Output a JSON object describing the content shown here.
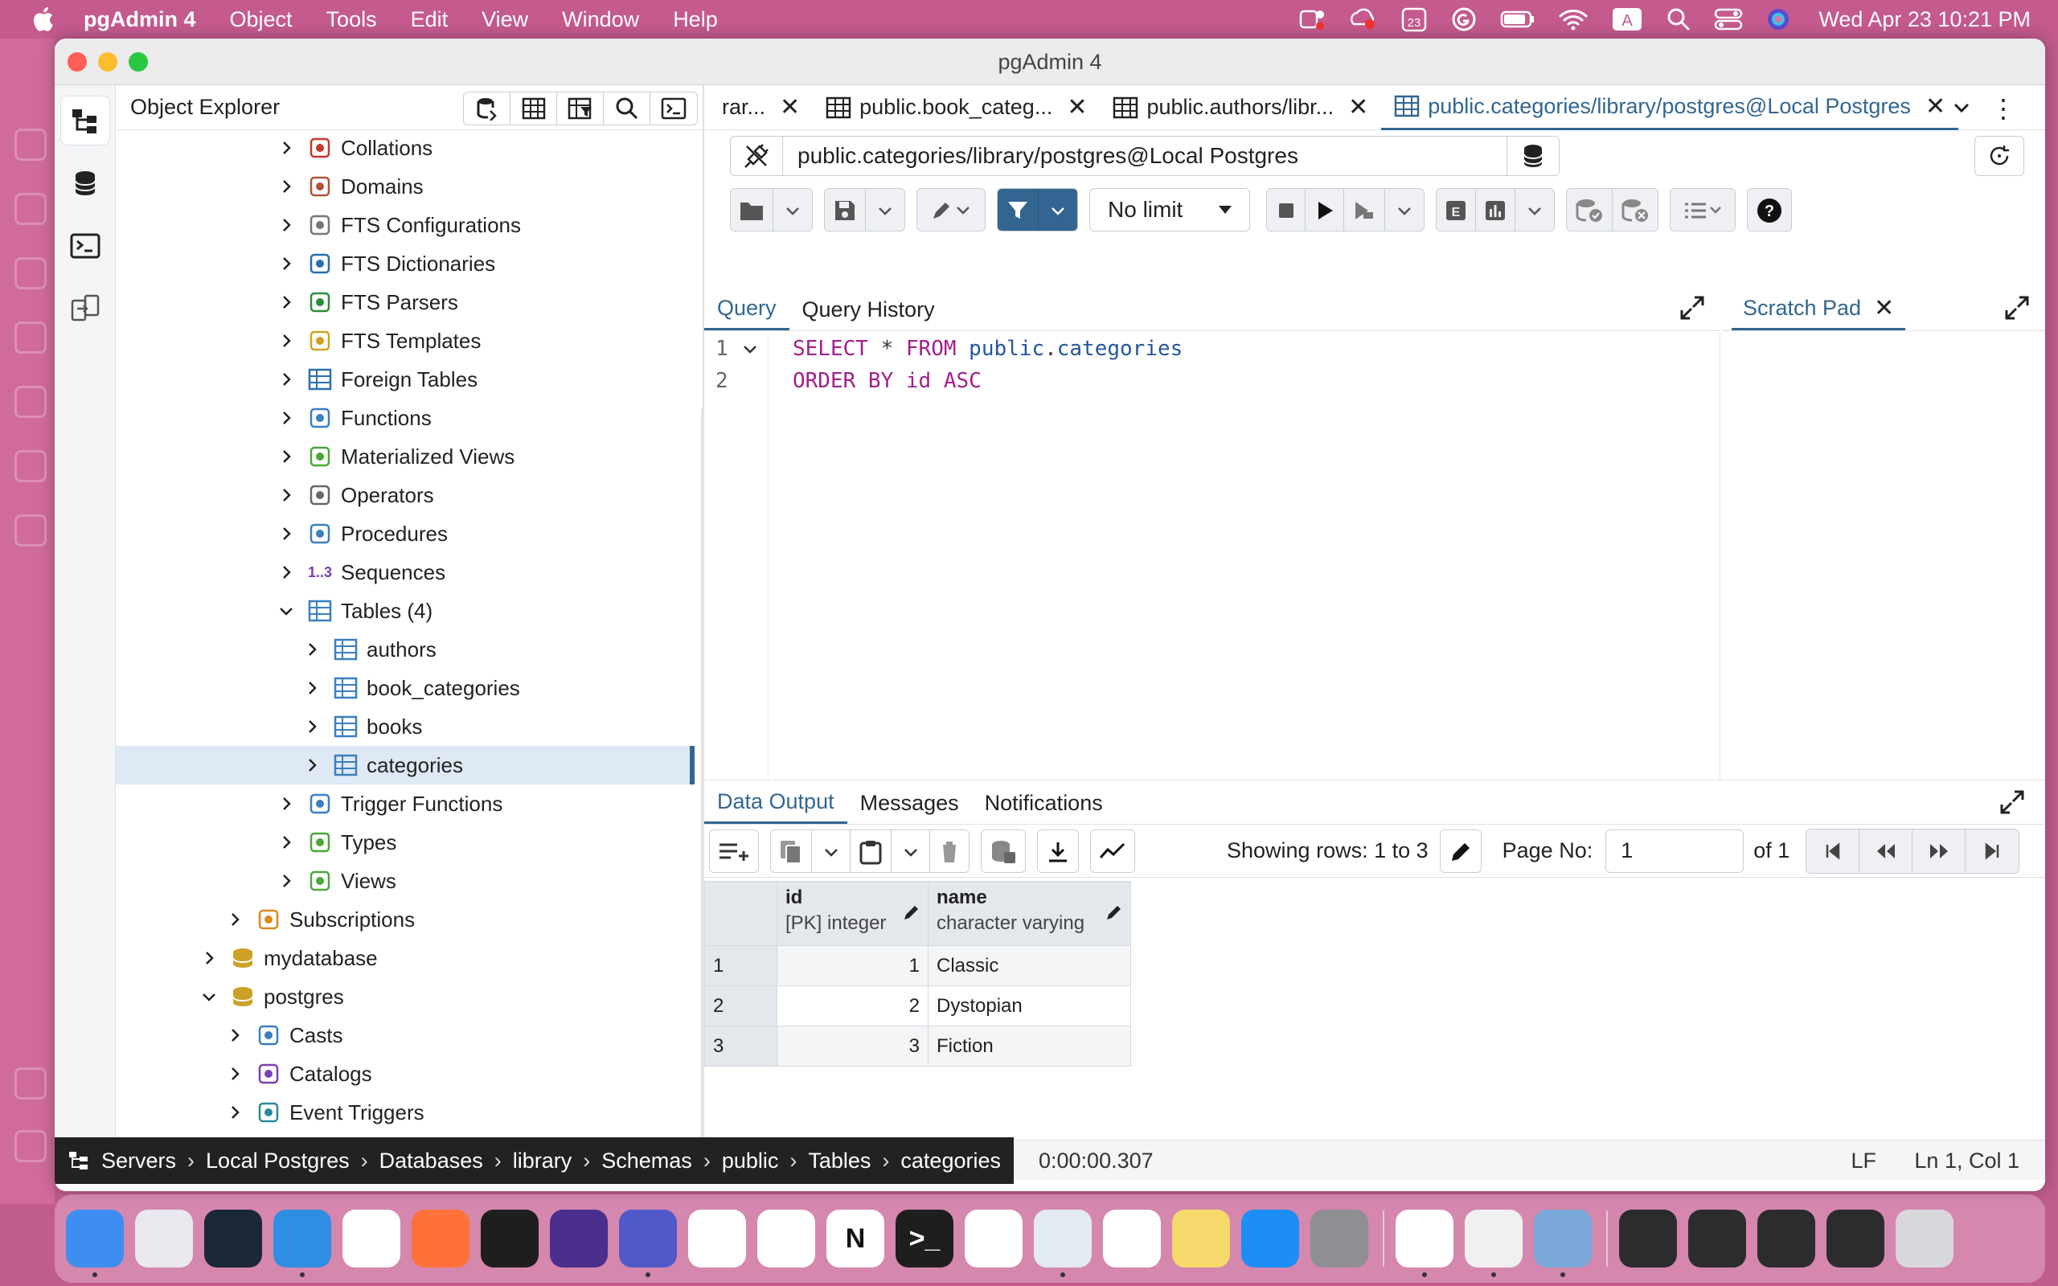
{
  "menubar": {
    "app_name": "pgAdmin 4",
    "menus": [
      "Object",
      "Tools",
      "Edit",
      "View",
      "Window",
      "Help"
    ],
    "calendar_badge": "23",
    "input_badge": "A",
    "clock": "Wed Apr 23  10:21 PM"
  },
  "window": {
    "title": "pgAdmin 4"
  },
  "explorer": {
    "title": "Object Explorer",
    "tree": [
      {
        "label": "Collations",
        "icon": "collations-icon",
        "level": 3,
        "expanded": false
      },
      {
        "label": "Domains",
        "icon": "domains-icon",
        "level": 3,
        "expanded": false
      },
      {
        "label": "FTS Configurations",
        "icon": "fts-config-icon",
        "level": 3,
        "expanded": false
      },
      {
        "label": "FTS Dictionaries",
        "icon": "fts-dictionary-icon",
        "level": 3,
        "expanded": false
      },
      {
        "label": "FTS Parsers",
        "icon": "fts-parser-icon",
        "level": 3,
        "expanded": false
      },
      {
        "label": "FTS Templates",
        "icon": "fts-template-icon",
        "level": 3,
        "expanded": false
      },
      {
        "label": "Foreign Tables",
        "icon": "foreign-table-icon",
        "level": 3,
        "expanded": false
      },
      {
        "label": "Functions",
        "icon": "function-icon",
        "level": 3,
        "expanded": false
      },
      {
        "label": "Materialized Views",
        "icon": "materialized-view-icon",
        "level": 3,
        "expanded": false
      },
      {
        "label": "Operators",
        "icon": "operator-icon",
        "level": 3,
        "expanded": false
      },
      {
        "label": "Procedures",
        "icon": "procedure-icon",
        "level": 3,
        "expanded": false
      },
      {
        "label": "Sequences",
        "icon": "sequence-icon",
        "level": 3,
        "expanded": false,
        "glyph": "1..3"
      },
      {
        "label": "Tables (4)",
        "icon": "tables-icon",
        "level": 3,
        "expanded": true
      },
      {
        "label": "authors",
        "icon": "table-icon",
        "level": 4,
        "expanded": false
      },
      {
        "label": "book_categories",
        "icon": "table-icon",
        "level": 4,
        "expanded": false
      },
      {
        "label": "books",
        "icon": "table-icon",
        "level": 4,
        "expanded": false
      },
      {
        "label": "categories",
        "icon": "table-icon",
        "level": 4,
        "expanded": false,
        "selected": true
      },
      {
        "label": "Trigger Functions",
        "icon": "trigger-function-icon",
        "level": 3,
        "expanded": false
      },
      {
        "label": "Types",
        "icon": "type-icon",
        "level": 3,
        "expanded": false
      },
      {
        "label": "Views",
        "icon": "view-icon",
        "level": 3,
        "expanded": false
      },
      {
        "label": "Subscriptions",
        "icon": "subscription-icon",
        "level": 2,
        "expanded": false
      },
      {
        "label": "mydatabase",
        "icon": "database-icon",
        "level": 1,
        "expanded": false
      },
      {
        "label": "postgres",
        "icon": "database-icon",
        "level": 1,
        "expanded": true
      },
      {
        "label": "Casts",
        "icon": "cast-icon",
        "level": 2,
        "expanded": false
      },
      {
        "label": "Catalogs",
        "icon": "catalog-icon",
        "level": 2,
        "expanded": false
      },
      {
        "label": "Event Triggers",
        "icon": "event-trigger-icon",
        "level": 2,
        "expanded": false
      }
    ]
  },
  "tabs": [
    {
      "label": "rar...",
      "active": false,
      "icon": false
    },
    {
      "label": "public.book_categ...",
      "active": false,
      "icon": true
    },
    {
      "label": "public.authors/libr...",
      "active": false,
      "icon": true
    },
    {
      "label": "public.categories/library/postgres@Local Postgres",
      "active": true,
      "icon": true
    }
  ],
  "connection": {
    "value": "public.categories/library/postgres@Local Postgres"
  },
  "toolbar": {
    "limit": "No limit"
  },
  "query_panel": {
    "tabs": [
      "Query",
      "Query History"
    ],
    "active_tab": "Query",
    "lines": [
      {
        "num": "1",
        "tokens": [
          {
            "t": "SELECT",
            "c": "kw"
          },
          {
            "t": " * ",
            "c": "plain"
          },
          {
            "t": "FROM",
            "c": "kw"
          },
          {
            "t": " ",
            "c": "plain"
          },
          {
            "t": "public",
            "c": "obj"
          },
          {
            "t": ".",
            "c": "plain"
          },
          {
            "t": "categories",
            "c": "obj"
          }
        ]
      },
      {
        "num": "2",
        "tokens": [
          {
            "t": "ORDER BY",
            "c": "kw"
          },
          {
            "t": " ",
            "c": "plain"
          },
          {
            "t": "id",
            "c": "kw"
          },
          {
            "t": " ",
            "c": "plain"
          },
          {
            "t": "ASC",
            "c": "kw"
          }
        ]
      }
    ]
  },
  "scratch_pad": {
    "label": "Scratch Pad"
  },
  "output": {
    "tabs": [
      "Data Output",
      "Messages",
      "Notifications"
    ],
    "active_tab": "Data Output",
    "rows_info": "Showing rows: 1 to 3",
    "page_label": "Page No:",
    "page_value": "1",
    "page_of": "of 1",
    "columns": [
      {
        "name": "id",
        "type": "[PK] integer"
      },
      {
        "name": "name",
        "type": "character varying"
      }
    ],
    "rows": [
      {
        "rownum": "1",
        "id": "1",
        "name": "Classic"
      },
      {
        "rownum": "2",
        "id": "2",
        "name": "Dystopian"
      },
      {
        "rownum": "3",
        "id": "3",
        "name": "Fiction"
      }
    ]
  },
  "statusbar": {
    "breadcrumb": [
      "Servers",
      "Local Postgres",
      "Databases",
      "library",
      "Schemas",
      "public",
      "Tables",
      "categories"
    ],
    "timer": "0:00:00.307",
    "line_ending": "LF",
    "cursor": "Ln 1, Col 1"
  },
  "colors": {
    "accent": "#326690",
    "keyword": "#a3208a",
    "identifier": "#25579c",
    "selection": "#dfe9f6"
  },
  "dock": {
    "apps": [
      {
        "name": "finder-icon",
        "color": "#3d8ef0",
        "glyph": "",
        "dot": true
      },
      {
        "name": "launchpad-icon",
        "color": "#e8e8ee",
        "glyph": "",
        "dot": false
      },
      {
        "name": "steam-icon",
        "color": "#1b2838",
        "glyph": "",
        "dot": false
      },
      {
        "name": "safari-icon",
        "color": "#2f8de4",
        "glyph": "",
        "dot": true
      },
      {
        "name": "opera-icon",
        "color": "#ffffff",
        "glyph": "",
        "dot": false
      },
      {
        "name": "firefox-icon",
        "color": "#ff7139",
        "glyph": "",
        "dot": false
      },
      {
        "name": "figma-icon",
        "color": "#1e1e1e",
        "glyph": "",
        "dot": false
      },
      {
        "name": "obsidian-icon",
        "color": "#4b2f8c",
        "glyph": "",
        "dot": false
      },
      {
        "name": "teams-icon",
        "color": "#5059c9",
        "glyph": "",
        "dot": true
      },
      {
        "name": "vscode-icon",
        "color": "#ffffff",
        "glyph": "",
        "dot": false
      },
      {
        "name": "github-icon",
        "color": "#ffffff",
        "glyph": "",
        "dot": false
      },
      {
        "name": "notion-icon",
        "color": "#ffffff",
        "glyph": "N",
        "dot": false
      },
      {
        "name": "terminal-icon",
        "color": "#1e1e1e",
        "glyph": ">_",
        "dot": false
      },
      {
        "name": "mongodb-icon",
        "color": "#ffffff",
        "glyph": "",
        "dot": false
      },
      {
        "name": "pgadmin-icon",
        "color": "#e4eaf2",
        "glyph": "",
        "dot": true
      },
      {
        "name": "photos-icon",
        "color": "#ffffff",
        "glyph": "",
        "dot": false
      },
      {
        "name": "notes-icon",
        "color": "#f6d96b",
        "glyph": "",
        "dot": false
      },
      {
        "name": "app-store-icon",
        "color": "#1d8ef5",
        "glyph": "",
        "dot": false
      },
      {
        "name": "system-settings-icon",
        "color": "#8e8e93",
        "glyph": "",
        "dot": false
      },
      {
        "name": "vscode-recent-icon",
        "color": "#ffffff",
        "glyph": "",
        "dot": true
      },
      {
        "name": "textedit-icon",
        "color": "#f0f0f0",
        "glyph": "",
        "dot": true
      },
      {
        "name": "preview-icon",
        "color": "#7aa8d8",
        "glyph": "",
        "dot": true
      },
      {
        "name": "window-thumb-1",
        "color": "#2c2c2e",
        "glyph": "",
        "dot": false
      },
      {
        "name": "window-thumb-2",
        "color": "#2c2c2e",
        "glyph": "",
        "dot": false
      },
      {
        "name": "window-thumb-3",
        "color": "#2c2c2e",
        "glyph": "",
        "dot": false
      },
      {
        "name": "window-thumb-4",
        "color": "#2c2c2e",
        "glyph": "",
        "dot": false
      },
      {
        "name": "trash-icon",
        "color": "#d8d8dc",
        "glyph": "",
        "dot": false
      }
    ]
  }
}
